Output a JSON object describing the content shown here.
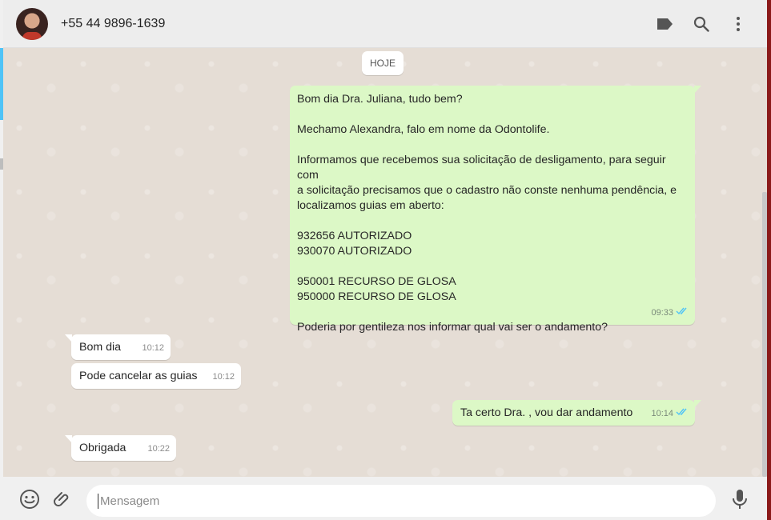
{
  "header": {
    "contact_name": "+55 44 9896-1639",
    "icons": [
      "label-icon",
      "search-icon",
      "menu-icon"
    ]
  },
  "chat": {
    "date_label": "HOJE",
    "messages": [
      {
        "direction": "out",
        "text": "Bom dia Dra. Juliana, tudo bem?\n\nMechamo Alexandra, falo em nome da Odontolife.\n\nInformamos que recebemos sua solicitação de desligamento, para seguir com\na solicitação precisamos que o cadastro não conste nenhuma pendência, e\nlocalizamos guias em aberto:\n\n932656 AUTORIZADO\n930070 AUTORIZADO\n\n950001 RECURSO DE GLOSA\n950000 RECURSO DE GLOSA\n\nPoderia por gentileza nos informar qual vai ser o andamento?",
        "time": "09:33",
        "status": "read"
      },
      {
        "direction": "in",
        "text": "Bom dia",
        "time": "10:12"
      },
      {
        "direction": "in",
        "text": "Pode cancelar as guias",
        "time": "10:12"
      },
      {
        "direction": "out",
        "text": "Ta certo Dra. , vou dar andamento",
        "time": "10:14",
        "status": "read"
      },
      {
        "direction": "in",
        "text": "Obrigada",
        "time": "10:22"
      }
    ]
  },
  "composer": {
    "placeholder": "Mensagem",
    "icons": [
      "emoji-icon",
      "attach-icon",
      "mic-icon"
    ]
  },
  "colors": {
    "outgoing_bubble": "#dcf8c6",
    "incoming_bubble": "#ffffff",
    "chat_background": "#e5ddd5",
    "read_tick": "#4fc3f7"
  }
}
